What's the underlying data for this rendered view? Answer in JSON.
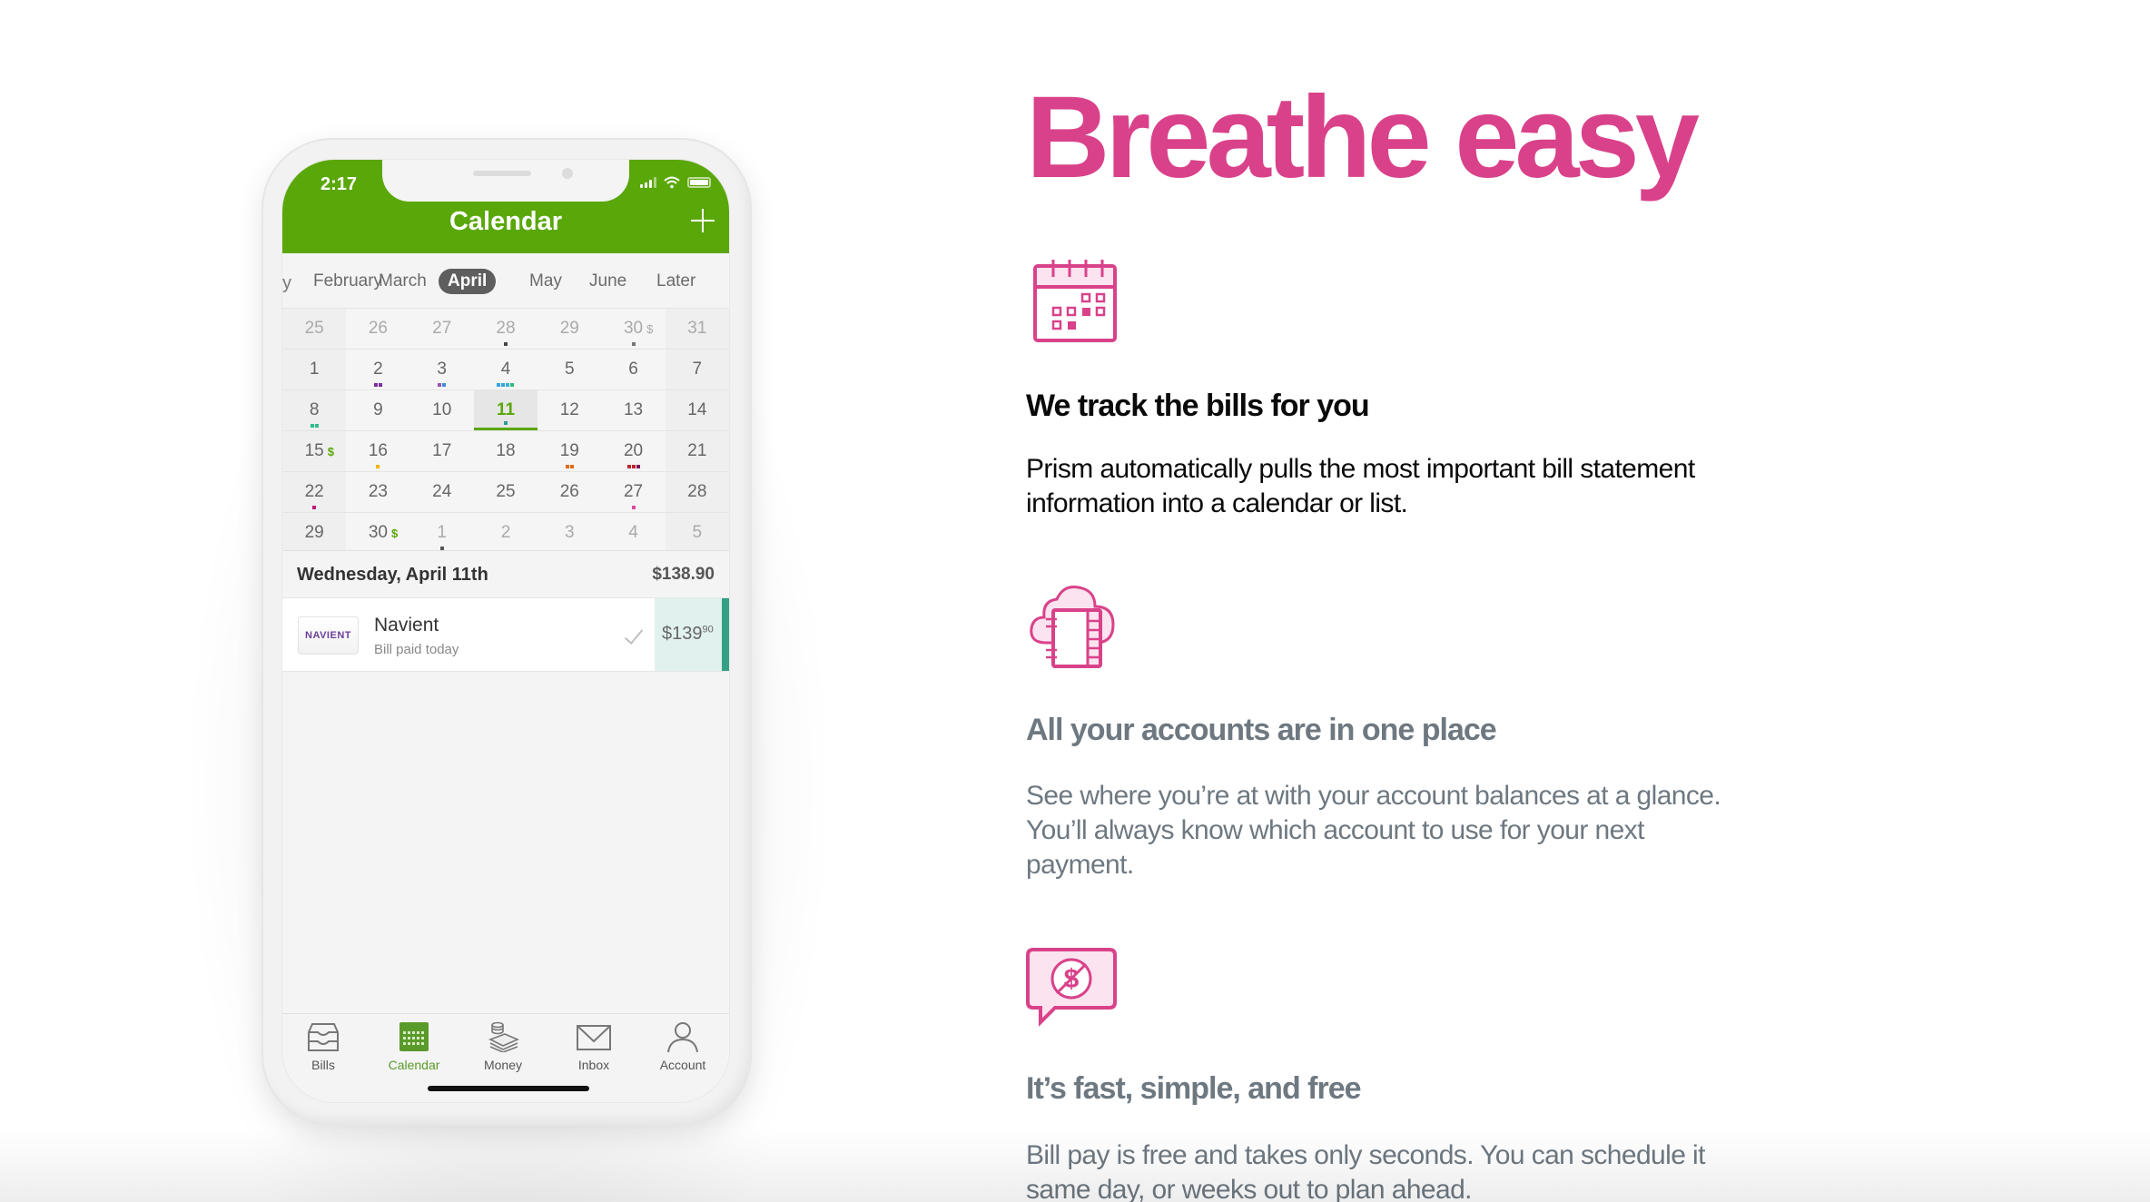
{
  "colors": {
    "brand_pink": "#d9428a",
    "app_green": "#5aa70a",
    "paid_teal": "#33a085",
    "muted_text": "#6e7881"
  },
  "phone": {
    "status_bar": {
      "time": "2:17"
    },
    "header": {
      "title": "Calendar",
      "add_icon": "plus-icon"
    },
    "months": {
      "prev_edge": "y",
      "items": [
        "February",
        "March",
        "April",
        "May",
        "June",
        "Later"
      ],
      "selected": "April"
    },
    "calendar": {
      "weeks": [
        [
          {
            "day": "25",
            "muted": true
          },
          {
            "day": "26",
            "muted": true
          },
          {
            "day": "27",
            "muted": true
          },
          {
            "day": "28",
            "muted": true,
            "dots": [
              "#444444"
            ]
          },
          {
            "day": "29",
            "muted": true
          },
          {
            "day": "30",
            "muted": true,
            "cash": "$",
            "dots": [
              "#777777"
            ]
          },
          {
            "day": "31",
            "muted": true
          }
        ],
        [
          {
            "day": "1"
          },
          {
            "day": "2",
            "dots": [
              "#7b2f9e",
              "#7b2f9e"
            ]
          },
          {
            "day": "3",
            "dots": [
              "#9b4fb8",
              "#3a8fd6"
            ]
          },
          {
            "day": "4",
            "dots": [
              "#3aa3e0",
              "#3aa3e0",
              "#3ab0d6",
              "#2ebd7a"
            ]
          },
          {
            "day": "5"
          },
          {
            "day": "6"
          },
          {
            "day": "7"
          }
        ],
        [
          {
            "day": "8",
            "dots": [
              "#2ebd8a",
              "#2ebd8a"
            ]
          },
          {
            "day": "9"
          },
          {
            "day": "10"
          },
          {
            "day": "11",
            "today": true,
            "dots": [
              "#2a9d8f"
            ]
          },
          {
            "day": "12"
          },
          {
            "day": "13"
          },
          {
            "day": "14"
          }
        ],
        [
          {
            "day": "15",
            "cash": "$"
          },
          {
            "day": "16",
            "dots": [
              "#f2b600"
            ]
          },
          {
            "day": "17"
          },
          {
            "day": "18"
          },
          {
            "day": "19",
            "dots": [
              "#e06a1b",
              "#e06a1b"
            ]
          },
          {
            "day": "20",
            "dots": [
              "#c0262d",
              "#c0262d",
              "#7a1a5a"
            ]
          },
          {
            "day": "21"
          }
        ],
        [
          {
            "day": "22",
            "dots": [
              "#c2187a"
            ]
          },
          {
            "day": "23"
          },
          {
            "day": "24"
          },
          {
            "day": "25"
          },
          {
            "day": "26"
          },
          {
            "day": "27",
            "dots": [
              "#d94aa0"
            ]
          },
          {
            "day": "28"
          }
        ],
        [
          {
            "day": "29"
          },
          {
            "day": "30",
            "cash": "$"
          },
          {
            "day": "1",
            "muted": true,
            "dots": [
              "#555555"
            ]
          },
          {
            "day": "2",
            "muted": true
          },
          {
            "day": "3",
            "muted": true
          },
          {
            "day": "4",
            "muted": true
          },
          {
            "day": "5",
            "muted": true
          }
        ]
      ]
    },
    "selected_day": {
      "label": "Wednesday, April 11th",
      "total": "$138.90"
    },
    "bills": [
      {
        "logo_text": "NAVIENT",
        "name": "Navient",
        "status": "Bill paid today",
        "amount_dollars": "$139",
        "amount_cents": "90",
        "paid": true
      }
    ],
    "tabbar": {
      "items": [
        {
          "label": "Bills",
          "icon": "inbox-tray-icon",
          "active": false
        },
        {
          "label": "Calendar",
          "icon": "calendar-icon",
          "active": true
        },
        {
          "label": "Money",
          "icon": "money-stack-icon",
          "active": false
        },
        {
          "label": "Inbox",
          "icon": "envelope-icon",
          "active": false
        },
        {
          "label": "Account",
          "icon": "person-icon",
          "active": false
        }
      ]
    }
  },
  "hero": {
    "title": "Breathe easy"
  },
  "features": [
    {
      "icon": "calendar-icon",
      "title": "We track the bills for you",
      "text": "Prism automatically pulls the most important bill statement information into a calendar or list."
    },
    {
      "icon": "cloud-notebook-icon",
      "title": "All your accounts are in one place",
      "text": "See where you’re at with your account balances at a glance. You’ll always know which account to use for your next payment."
    },
    {
      "icon": "no-fee-chat-icon",
      "title": "It’s fast, simple, and free",
      "text": "Bill pay is free and takes only seconds. You can schedule it same day, or weeks out to plan ahead."
    }
  ]
}
